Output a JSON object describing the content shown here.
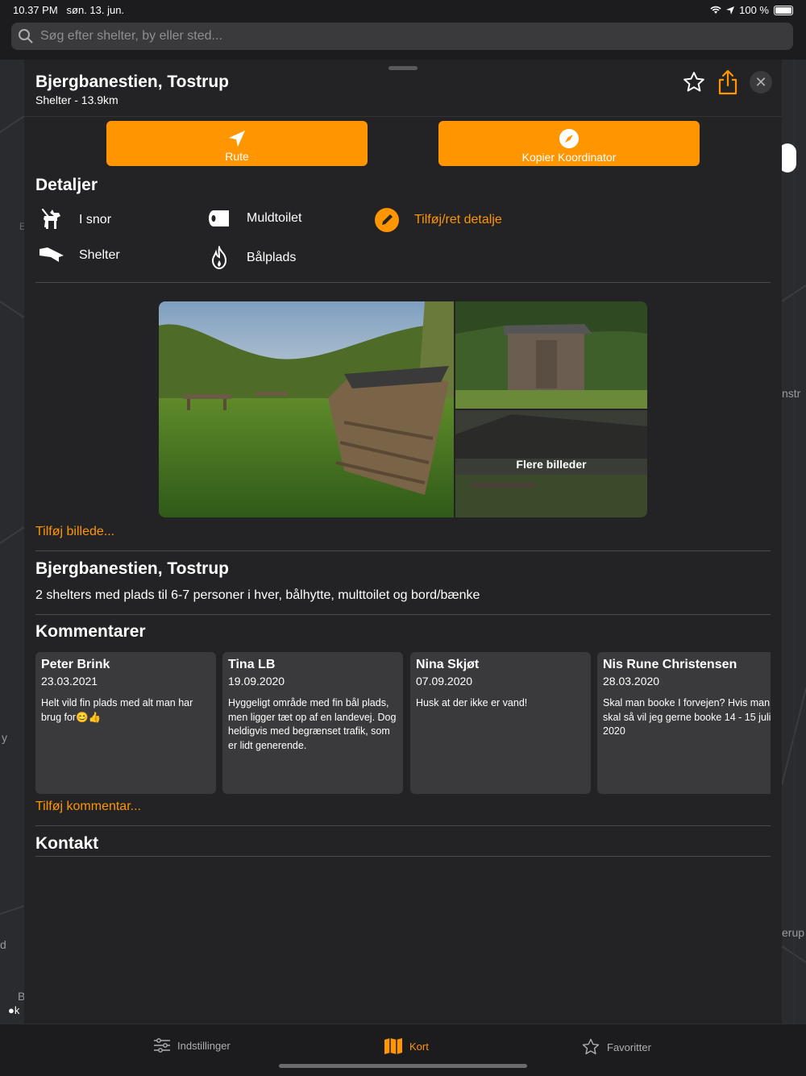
{
  "status": {
    "time": "10.37 PM",
    "date": "søn. 13. jun.",
    "battery": "100 %"
  },
  "search": {
    "placeholder": "Søg efter shelter, by eller sted..."
  },
  "map_labels": {
    "edge1": "nstr",
    "edge2": "erup",
    "edge3": "B",
    "edge4": "y",
    "edge5": "E",
    "edge6": "d"
  },
  "place": {
    "title": "Bjergbanestien, Tostrup",
    "subtitle": "Shelter - 13.9km"
  },
  "actions": {
    "route": "Rute",
    "copy_coords": "Kopier Koordinator"
  },
  "details": {
    "heading": "Detaljer",
    "items": [
      {
        "label": "I snor",
        "icon": "dog-leash-icon"
      },
      {
        "label": "Muldtoilet",
        "icon": "toilet-paper-icon"
      },
      {
        "label": "Shelter",
        "icon": "shelter-icon"
      },
      {
        "label": "Bålplads",
        "icon": "fire-icon"
      }
    ],
    "edit": "Tilføj/ret detalje"
  },
  "gallery": {
    "more_label": "Flere billeder"
  },
  "add_image": "Tilføj billede...",
  "description": {
    "title": "Bjergbanestien, Tostrup",
    "text": "2 shelters med plads til 6-7 personer i hver, bålhytte, multtoilet og bord/bænke"
  },
  "comments": {
    "heading": "Kommentarer",
    "items": [
      {
        "name": "Peter Brink",
        "date": "23.03.2021",
        "text": "Helt vild fin plads med alt man har brug for😊👍"
      },
      {
        "name": "Tina LB",
        "date": "19.09.2020",
        "text": "Hyggeligt område med fin bål plads, men ligger tæt op af en landevej. Dog heldigvis med begrænset trafik, som er lidt generende."
      },
      {
        "name": "Nina Skjøt",
        "date": "07.09.2020",
        "text": "Husk at der ikke er vand!"
      },
      {
        "name": "Nis Rune Christensen",
        "date": "28.03.2020",
        "text": "Skal man booke I forvejen? Hvis man skal så vil jeg gerne booke 14 - 15 juli 2020"
      }
    ],
    "add": "Tilføj kommentar..."
  },
  "contact": {
    "heading": "Kontakt"
  },
  "tabs": {
    "settings": "Indstillinger",
    "map": "Kort",
    "favorites": "Favoritter"
  },
  "colors": {
    "accent": "#ff9500",
    "sheet": "#232325",
    "card": "#3a3a3c"
  }
}
